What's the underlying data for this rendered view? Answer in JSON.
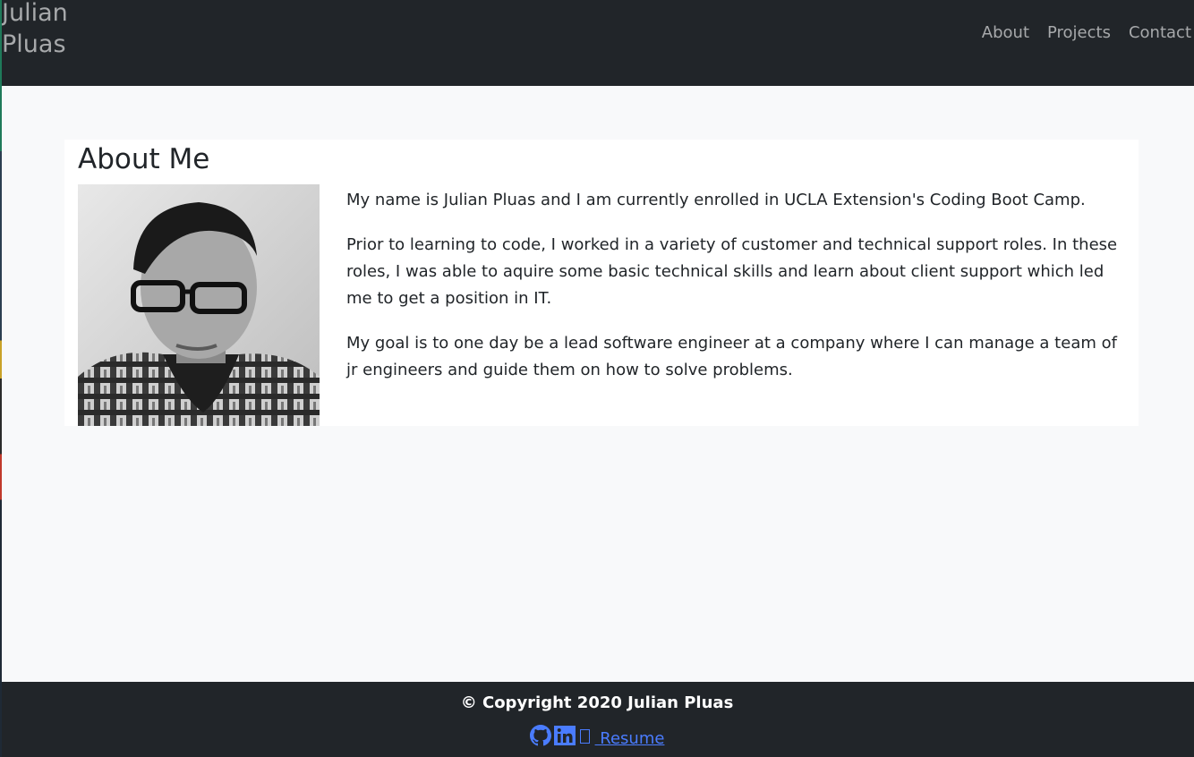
{
  "nav": {
    "brand": "Julian Pluas",
    "links": [
      "About",
      "Projects",
      "Contact"
    ]
  },
  "about": {
    "heading": "About Me",
    "paragraphs": [
      "My name is Julian Pluas and I am currently enrolled in UCLA Extension's Coding Boot Camp.",
      "Prior to learning to code, I worked in a variety of customer and technical support roles. In these roles, I was able to aquire some basic technical skills and learn about client support which led me to get a position in IT.",
      "My goal is to one day be a lead software engineer at a company where I can manage a team of jr engineers and guide them on how to solve problems."
    ]
  },
  "footer": {
    "copyright": "© Copyright 2020 Julian Pluas",
    "resume_label": " Resume",
    "icons": [
      "github-icon",
      "linkedin-icon",
      "file-icon"
    ]
  },
  "colors": {
    "navbar_bg": "#212529",
    "page_bg": "#f8f9fa",
    "link": "#4a7cff",
    "nav_text": "#a7a9ab"
  }
}
